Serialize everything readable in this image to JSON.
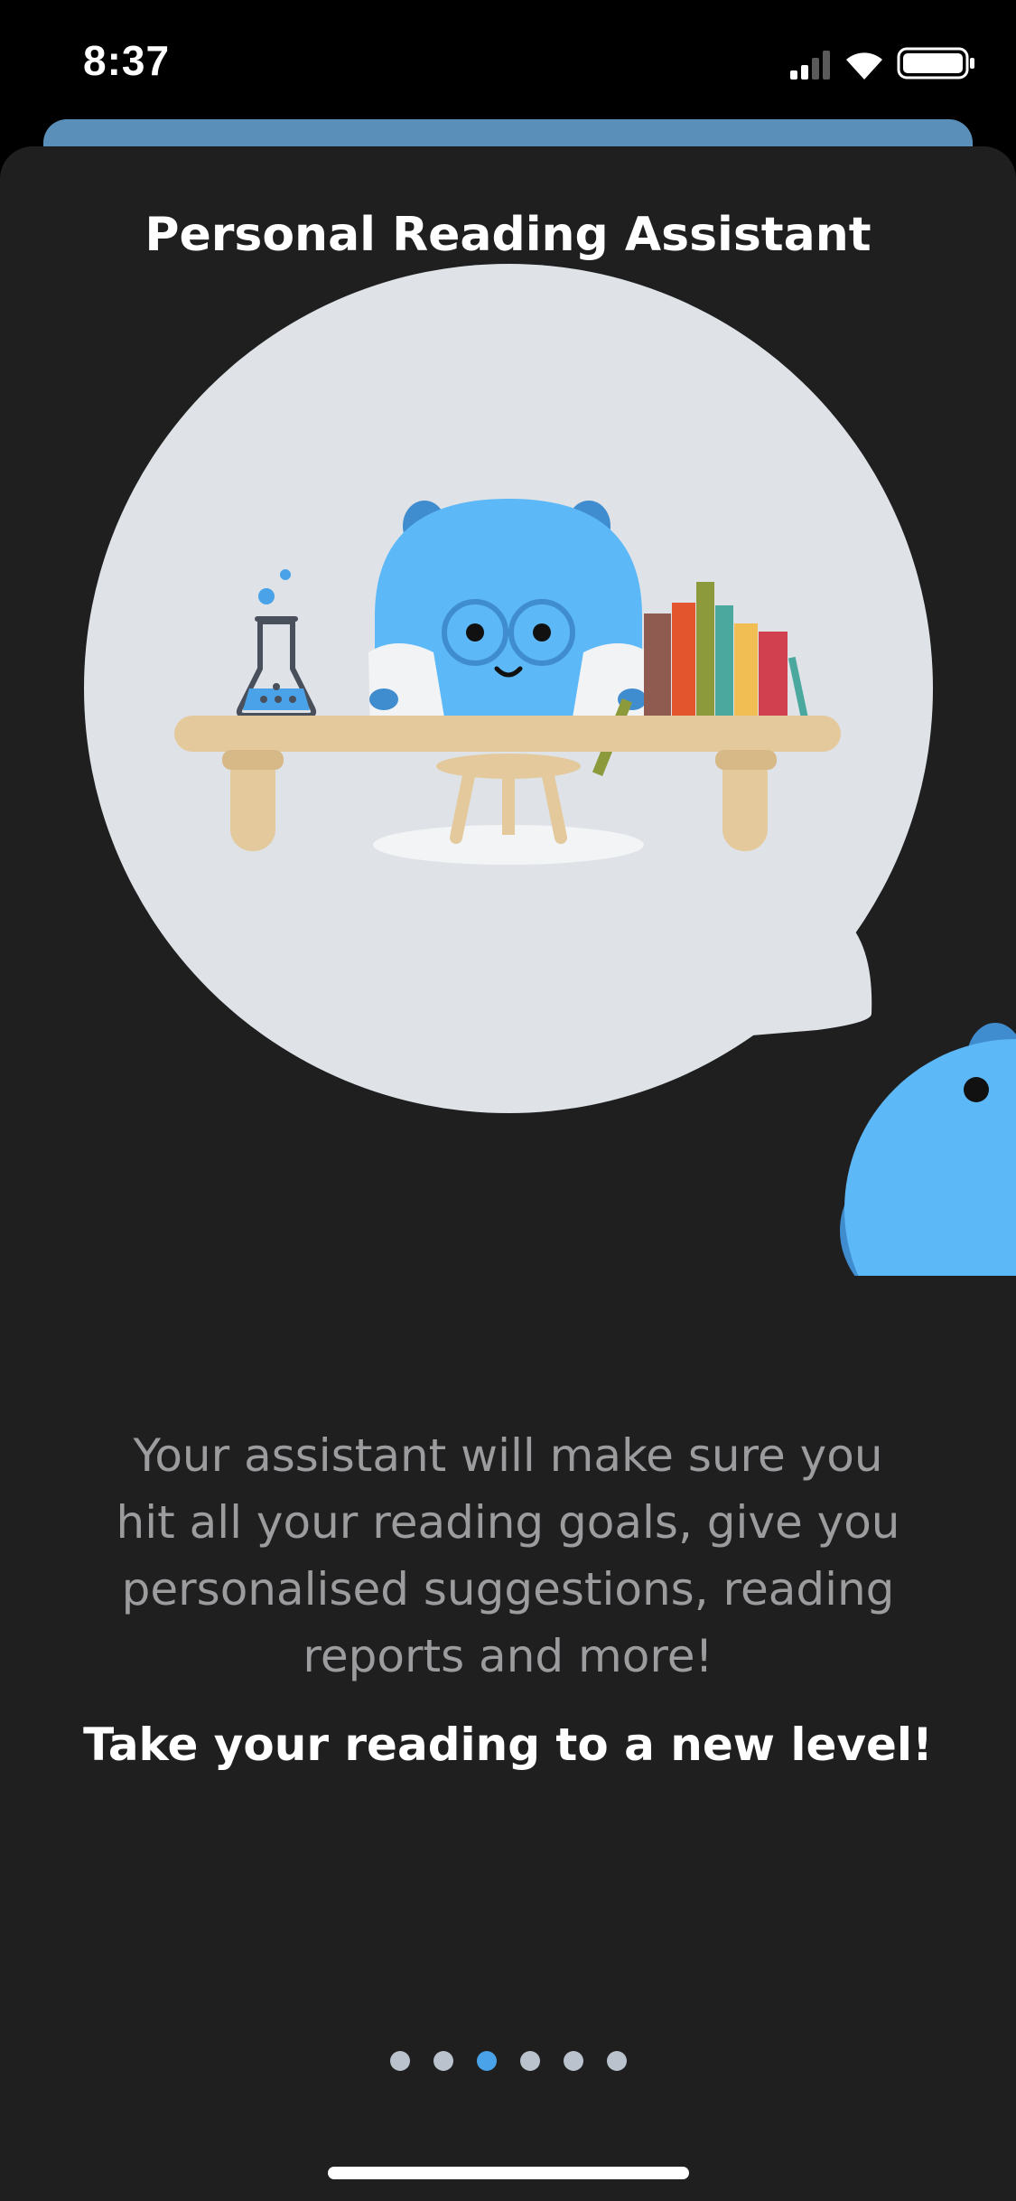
{
  "status_bar": {
    "time": "8:37",
    "icons": [
      "cellular-signal-icon",
      "wifi-icon",
      "battery-icon"
    ]
  },
  "onboarding": {
    "title": "Personal Reading Assistant",
    "description": "Your assistant will make sure you hit all your reading goals, give you personalised suggestions, reading reports and more!",
    "cta": "Take your reading to a new level!",
    "pagination": {
      "total": 6,
      "active_index": 2
    }
  },
  "colors": {
    "background": "#1f1f20",
    "accent": "#4aa3e8",
    "mascot_blue": "#5db8f8",
    "desk": "#e3c99c",
    "bubble": "#dfe3e8"
  }
}
